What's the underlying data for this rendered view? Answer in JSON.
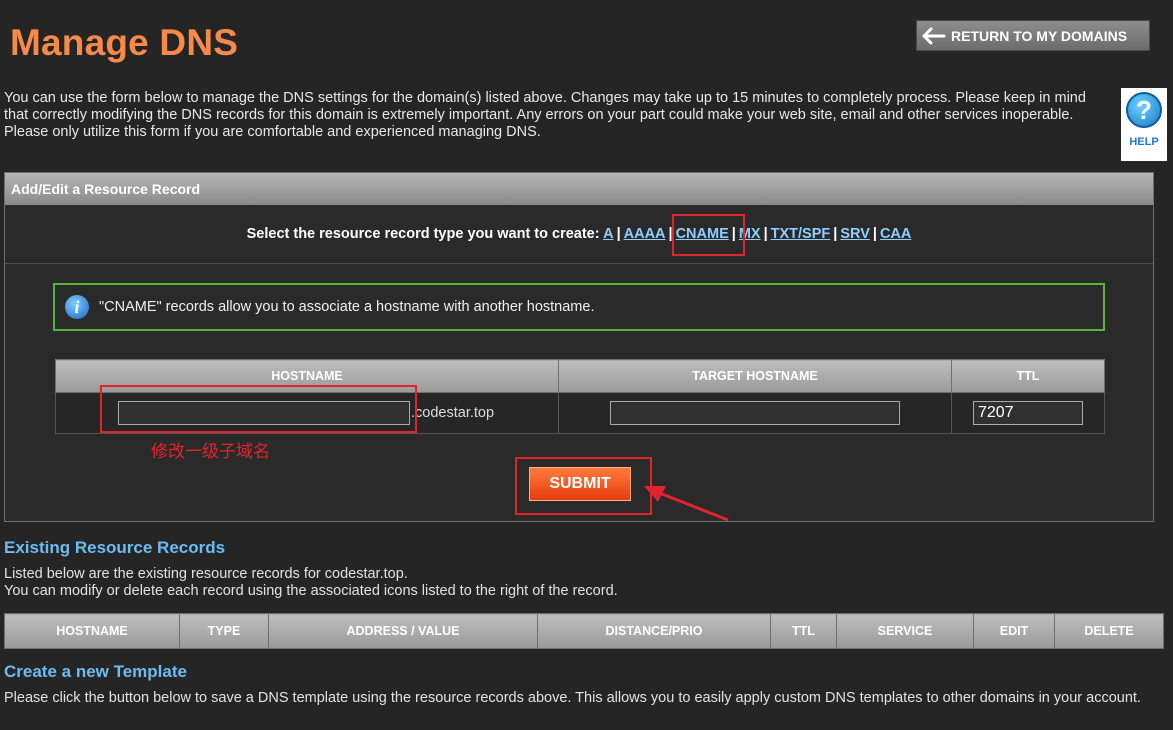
{
  "page_title": "Manage DNS",
  "return_button": "RETURN TO MY DOMAINS",
  "intro": "You can use the form below to manage the DNS settings for the domain(s) listed above. Changes may take up to 15 minutes to completely process. Please keep in mind that correctly modifying the DNS records for this domain is extremely important. Any errors on your part could make your web site, email and other services inoperable. Please only utilize this form if you are comfortable and experienced managing DNS.",
  "help_label": "HELP",
  "panel": {
    "title": "Add/Edit a Resource Record",
    "select_prompt": "Select the resource record type you want to create:",
    "record_types": [
      "A",
      "AAAA",
      "CNAME",
      "MX",
      "TXT/SPF",
      "SRV",
      "CAA"
    ],
    "selected_type": "CNAME",
    "info_message": "\"CNAME\" records allow you to associate a hostname with another hostname.",
    "columns": [
      "HOSTNAME",
      "TARGET HOSTNAME",
      "TTL"
    ],
    "hostname_value": "",
    "domain_suffix": ".codestar.top",
    "target_value": "",
    "ttl_value": "7207",
    "annotation": "修改一级子域名",
    "submit_label": "SUBMIT"
  },
  "existing": {
    "title": "Existing Resource Records",
    "line1": "Listed below are the existing resource records for codestar.top.",
    "line2": "You can modify or delete each record using the associated icons listed to the right of the record.",
    "columns": [
      "HOSTNAME",
      "TYPE",
      "ADDRESS / VALUE",
      "DISTANCE/PRIO",
      "TTL",
      "SERVICE",
      "EDIT",
      "DELETE"
    ]
  },
  "template": {
    "title": "Create a new Template",
    "text": "Please click the button below to save a DNS template using the resource records above. This allows you to easily apply custom DNS templates to other domains in your account."
  },
  "colors": {
    "background": "#252525",
    "title": "#f58a4b",
    "link": "#8fd0ff",
    "section_title": "#6cbcf2",
    "annotation_red": "#e0242c",
    "info_border": "#59b33a",
    "submit": "#ff5a1f"
  },
  "icons": {
    "return": "arrow-left-icon",
    "help": "question-mark-icon",
    "info": "info-icon"
  }
}
